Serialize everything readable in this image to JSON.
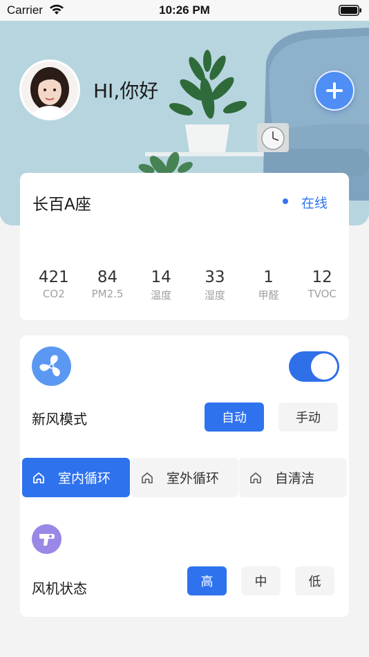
{
  "status_bar": {
    "carrier": "Carrier",
    "time": "10:26 PM"
  },
  "header": {
    "greeting": "HI,你好",
    "add_icon": "plus-icon",
    "avatar_icon": "user-avatar"
  },
  "device": {
    "name": "长百A座",
    "status": "在线",
    "status_color": "#2f74ee",
    "metrics": [
      {
        "value": "421",
        "label": "CO2"
      },
      {
        "value": "84",
        "label": "PM2.5"
      },
      {
        "value": "14",
        "label": "温度"
      },
      {
        "value": "33",
        "label": "湿度"
      },
      {
        "value": "1",
        "label": "甲醛"
      },
      {
        "value": "12",
        "label": "TVOC"
      }
    ]
  },
  "controls": {
    "fan_icon": "fan-icon",
    "power_on": true,
    "mode_label": "新风模式",
    "modes": [
      {
        "label": "自动",
        "active": true
      },
      {
        "label": "手动",
        "active": false
      }
    ],
    "circulation": [
      {
        "label": "室内循环",
        "icon": "home-icon",
        "active": true
      },
      {
        "label": "室外循环",
        "icon": "home-icon",
        "active": false
      },
      {
        "label": "自清洁",
        "icon": "home-icon",
        "active": false
      }
    ],
    "blower_icon": "blower-icon",
    "fan_state_label": "风机状态",
    "speeds": [
      {
        "label": "高",
        "active": true
      },
      {
        "label": "中",
        "active": false
      },
      {
        "label": "低",
        "active": false
      }
    ],
    "accent_color": "#2f72ee"
  }
}
